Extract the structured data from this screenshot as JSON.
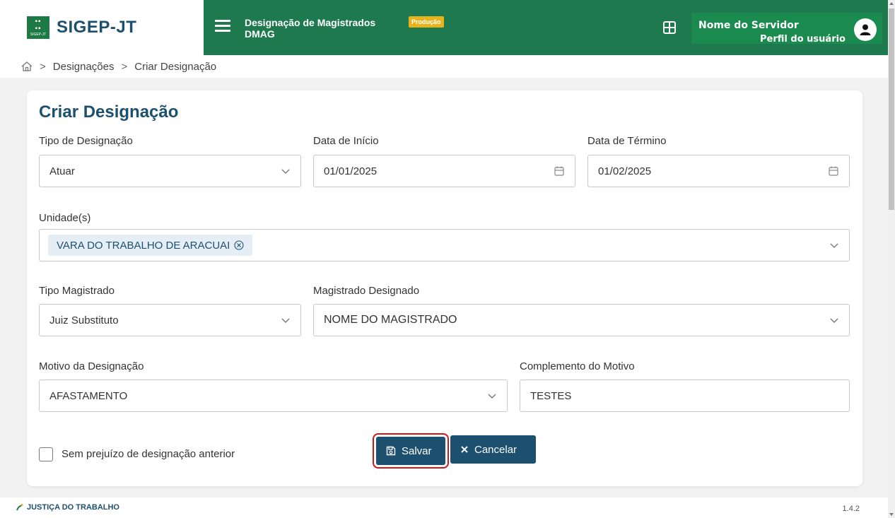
{
  "brand": {
    "name": "SIGEP-JT",
    "logo_text": "SIGEP-JT"
  },
  "topbar": {
    "title_line1": "Designação de Magistrados",
    "title_line2": "DMAG",
    "env_badge": "Produção",
    "user_name": "Nome do Servidor",
    "user_profile": "Perfil do usuário"
  },
  "breadcrumb": {
    "home_icon": "home-icon",
    "items": [
      "Designações",
      "Criar Designação"
    ]
  },
  "form": {
    "title": "Criar Designação",
    "tipo_designacao": {
      "label": "Tipo de Designação",
      "value": "Atuar"
    },
    "data_inicio": {
      "label": "Data de Início",
      "value": "01/01/2025"
    },
    "data_termino": {
      "label": "Data de Término",
      "value": "01/02/2025"
    },
    "unidades": {
      "label": "Unidade(s)",
      "tags": [
        "VARA DO TRABALHO DE ARACUAI"
      ]
    },
    "tipo_magistrado": {
      "label": "Tipo Magistrado",
      "value": "Juiz Substituto"
    },
    "magistrado_designado": {
      "label": "Magistrado Designado",
      "value": "NOME DO MAGISTRADO"
    },
    "motivo": {
      "label": "Motivo da Designação",
      "value": "AFASTAMENTO"
    },
    "complemento": {
      "label": "Complemento do Motivo",
      "value": "TESTES"
    },
    "sem_prejuizo": {
      "label": "Sem prejuízo de designação anterior",
      "checked": false
    },
    "save_label": "Salvar",
    "cancel_label": "Cancelar"
  },
  "footer": {
    "logo_text": "JUSTIÇA DO TRABALHO",
    "version": "1.4.2"
  },
  "colors": {
    "primary": "#1d4f6e",
    "header_green": "#1e7a4e",
    "badge": "#e8b21a",
    "highlight": "#d01818"
  }
}
